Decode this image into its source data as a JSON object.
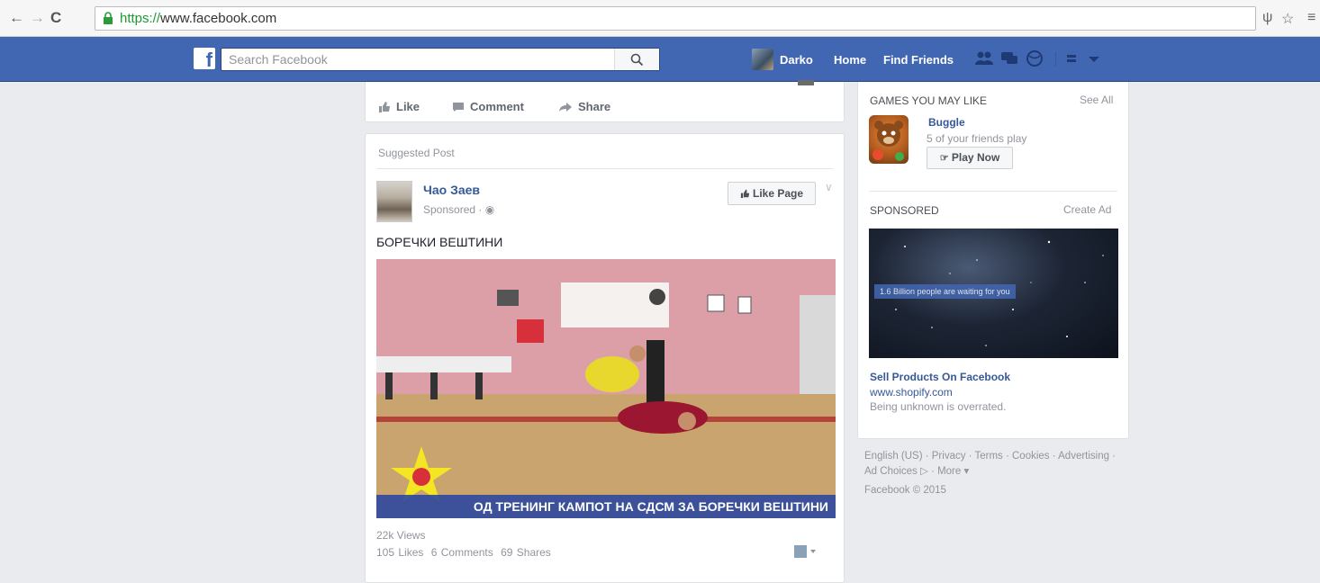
{
  "browser": {
    "url_scheme": "https://",
    "url_host": "www.facebook.com"
  },
  "fbbar": {
    "logo": "f",
    "search_placeholder": "Search Facebook",
    "user_name": "Darko",
    "home": "Home",
    "find_friends": "Find Friends"
  },
  "top_actions": {
    "like": "Like",
    "comment": "Comment",
    "share": "Share"
  },
  "post": {
    "suggested": "Suggested Post",
    "page_name": "Чао Заев",
    "sponsored": "Sponsored · ",
    "like_page": "Like Page",
    "text": "БОРЕЧКИ ВЕШТИНИ",
    "video_caption": "ОД ТРЕНИНГ КАМПОТ НА СДСМ ЗА БОРЕЧКИ ВЕШТИНИ",
    "views": "22k Views",
    "likes": "105 Likes",
    "comments": "6 Comments",
    "shares": "69 Shares"
  },
  "games": {
    "heading": "GAMES YOU MAY LIKE",
    "see_all": "See All",
    "game_name": "Buggle",
    "game_sub": "5 of your friends play",
    "play_now": "Play Now"
  },
  "sponsored": {
    "heading": "SPONSORED",
    "create_ad": "Create Ad",
    "banner": "1.6 Billion people are waiting for you",
    "title": "Sell Products On Facebook",
    "url": "www.shopify.com",
    "desc": "Being unknown is overrated."
  },
  "footer": {
    "links": "English (US) · Privacy · Terms · Cookies · Advertising · Ad Choices ▷ · More ▾",
    "copyright": "Facebook © 2015"
  },
  "colors": {
    "brand_blue": "#4267b2",
    "link_blue": "#365899"
  }
}
